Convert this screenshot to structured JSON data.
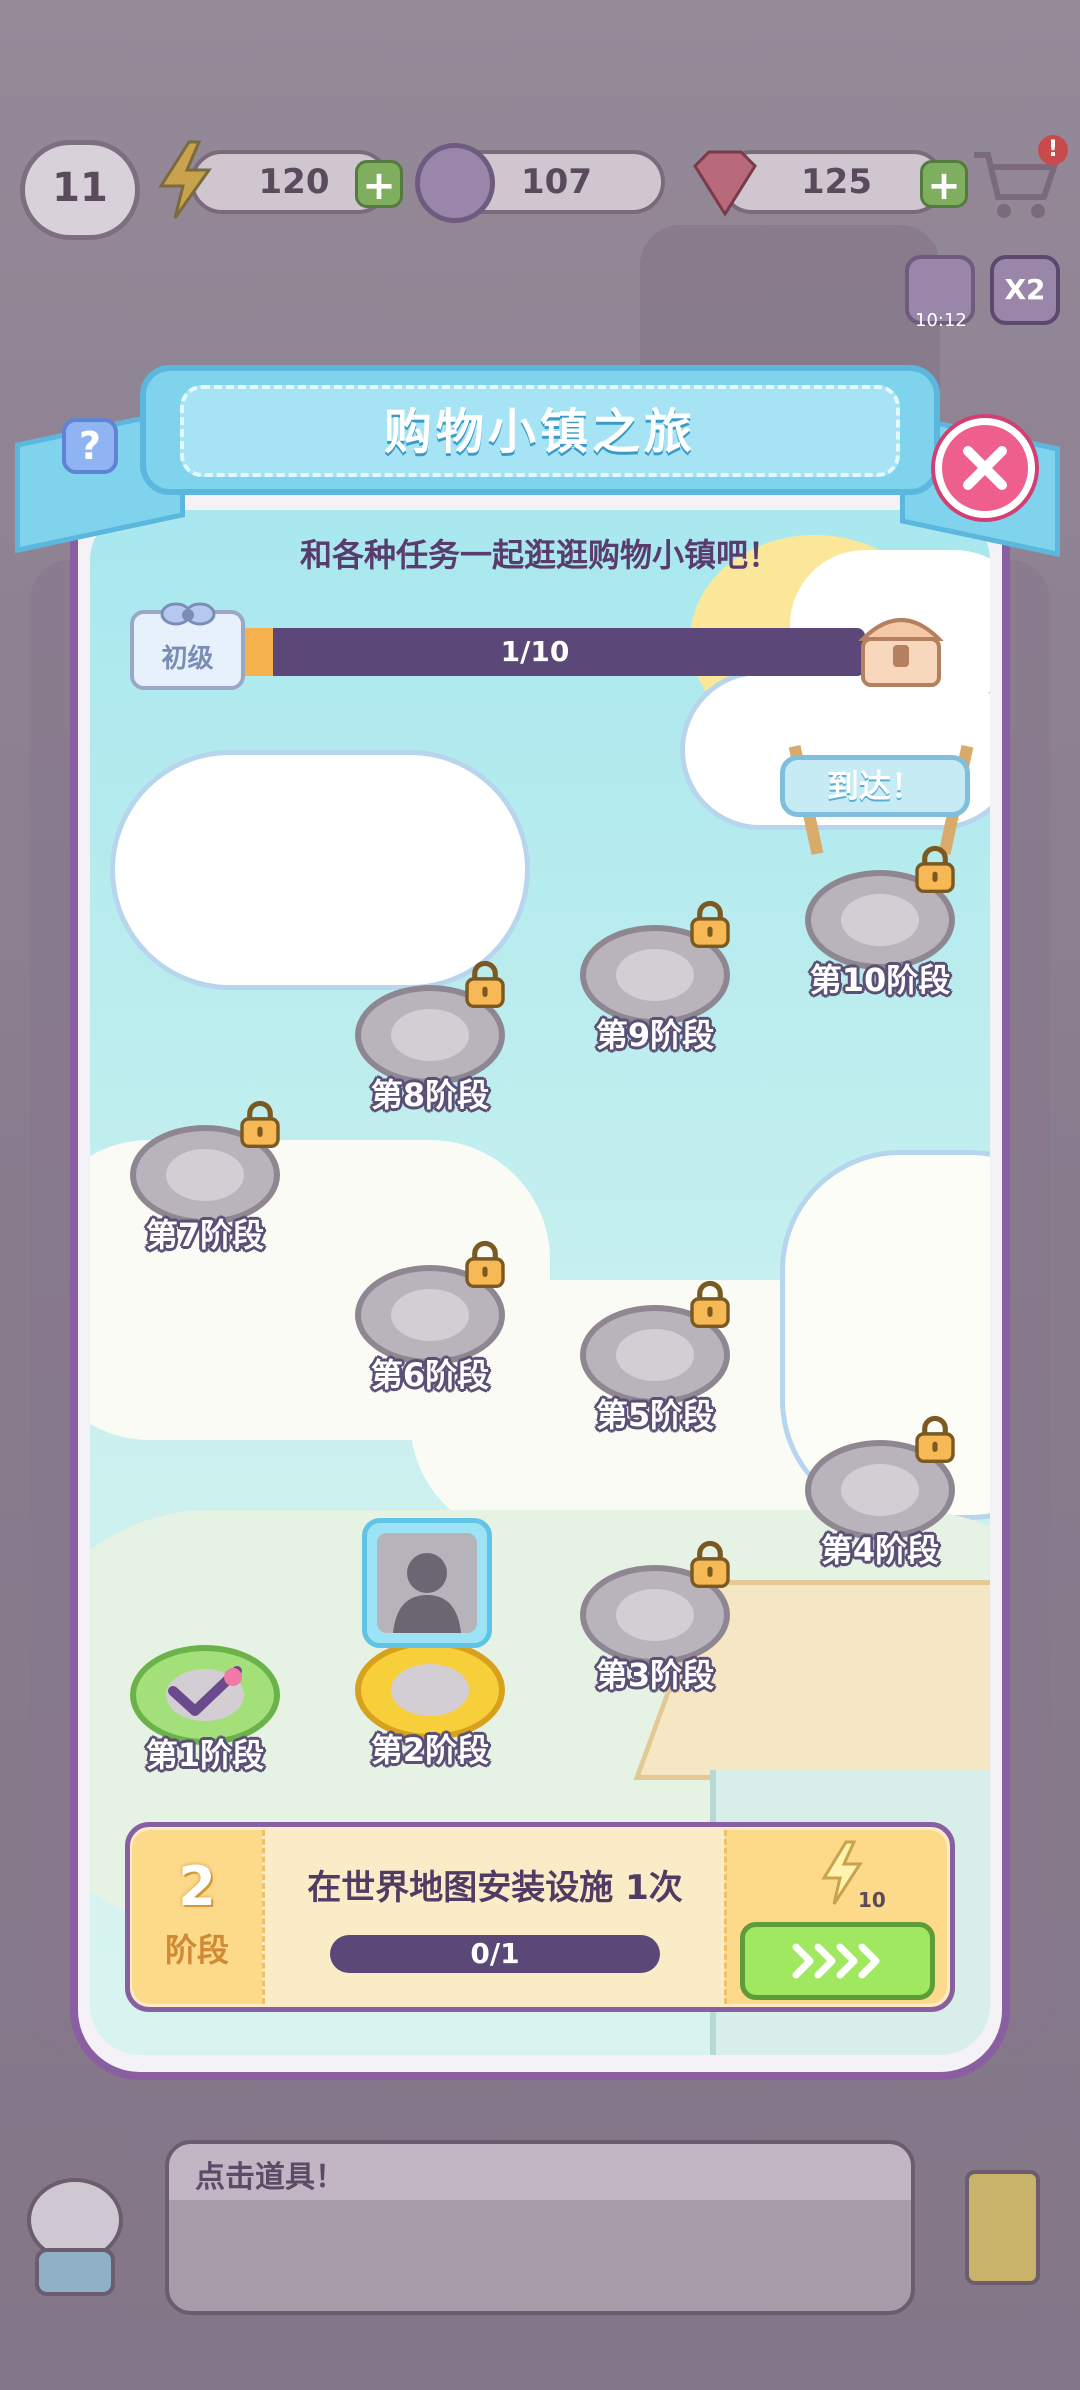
{
  "hud": {
    "level": "11",
    "energy": "120",
    "coins": "107",
    "gems": "125",
    "boost_timer": "10:12",
    "multiplier": "X2",
    "plus_label": "+"
  },
  "modal": {
    "title": "购物小镇之旅",
    "subtitle": "和各种任务一起逛逛购物小镇吧！",
    "help_label": "?",
    "rank": "初级",
    "progress_text": "1/10",
    "progress_fraction": 0.1,
    "arrive_sign": "到达！"
  },
  "stages": [
    {
      "label": "第1阶段",
      "state": "completed"
    },
    {
      "label": "第2阶段",
      "state": "current"
    },
    {
      "label": "第3阶段",
      "state": "locked"
    },
    {
      "label": "第4阶段",
      "state": "locked"
    },
    {
      "label": "第5阶段",
      "state": "locked"
    },
    {
      "label": "第6阶段",
      "state": "locked"
    },
    {
      "label": "第7阶段",
      "state": "locked"
    },
    {
      "label": "第8阶段",
      "state": "locked"
    },
    {
      "label": "第9阶段",
      "state": "locked"
    },
    {
      "label": "第10阶段",
      "state": "locked"
    }
  ],
  "task": {
    "stage_number": "2",
    "stage_unit": "阶段",
    "description": "在世界地图安装设施 1次",
    "progress_text": "0/1",
    "progress_fraction": 0,
    "energy_reward": "10"
  },
  "footer": {
    "hint": "点击道具！"
  },
  "colors": {
    "accent_purple": "#8a5fa1",
    "banner_blue": "#7fd3ec",
    "close_pink": "#ee5f8d",
    "go_green": "#9fe85f",
    "progress_orange": "#f6b24e"
  }
}
